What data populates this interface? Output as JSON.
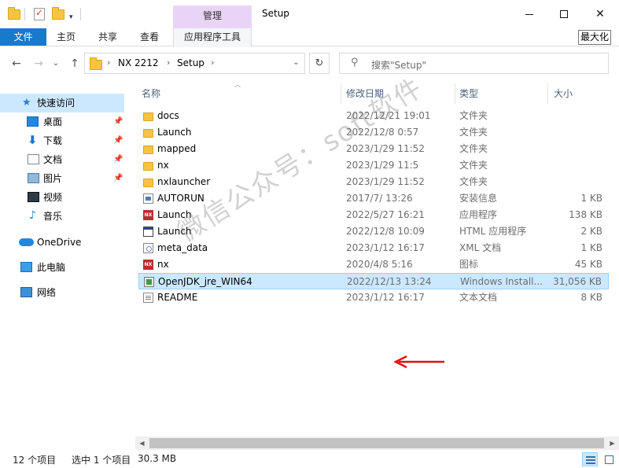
{
  "window": {
    "title": "Setup",
    "context_tab": "管理",
    "tooltip": "最大化"
  },
  "ribbon": {
    "tabs": [
      "文件",
      "主页",
      "共享",
      "查看",
      "应用程序工具"
    ]
  },
  "address": {
    "crumbs": [
      "NX 2212",
      "Setup"
    ],
    "search_placeholder": "搜索\"Setup\""
  },
  "nav": {
    "items": [
      {
        "label": "快速访问",
        "icon": "star-icon"
      },
      {
        "label": "桌面",
        "icon": "desktop-icon",
        "pinned": true
      },
      {
        "label": "下载",
        "icon": "download-icon",
        "pinned": true
      },
      {
        "label": "文档",
        "icon": "documents-icon",
        "pinned": true
      },
      {
        "label": "图片",
        "icon": "pictures-icon",
        "pinned": true
      },
      {
        "label": "视频",
        "icon": "videos-icon"
      },
      {
        "label": "音乐",
        "icon": "music-icon"
      },
      {
        "label": "OneDrive",
        "icon": "cloud-icon"
      },
      {
        "label": "此电脑",
        "icon": "computer-icon"
      },
      {
        "label": "网络",
        "icon": "network-icon"
      }
    ]
  },
  "columns": {
    "name": "名称",
    "date": "修改日期",
    "type": "类型",
    "size": "大小"
  },
  "files": [
    {
      "name": "docs",
      "date": "2022/12/21 19:01",
      "type": "文件夹",
      "size": "",
      "icon": "folder"
    },
    {
      "name": "Launch",
      "date": "2022/12/8 0:57",
      "type": "文件夹",
      "size": "",
      "icon": "folder"
    },
    {
      "name": "mapped",
      "date": "2023/1/29 11:52",
      "type": "文件夹",
      "size": "",
      "icon": "folder"
    },
    {
      "name": "nx",
      "date": "2023/1/29 11:5",
      "type": "文件夹",
      "size": "",
      "icon": "folder"
    },
    {
      "name": "nxlauncher",
      "date": "2023/1/29 11:52",
      "type": "文件夹",
      "size": "",
      "icon": "folder"
    },
    {
      "name": "AUTORUN",
      "date": "2017/7/ 13:26",
      "type": "安装信息",
      "size": "1 KB",
      "icon": "inf"
    },
    {
      "name": "Launch",
      "date": "2022/5/27 16:21",
      "type": "应用程序",
      "size": "138 KB",
      "icon": "nx"
    },
    {
      "name": "Launch",
      "date": "2022/12/8 10:09",
      "type": "HTML 应用程序",
      "size": "2 KB",
      "icon": "html"
    },
    {
      "name": "meta_data",
      "date": "2023/1/12 16:17",
      "type": "XML 文档",
      "size": "1 KB",
      "icon": "xml"
    },
    {
      "name": "nx",
      "date": "2020/4/8 5:16",
      "type": "图标",
      "size": "45 KB",
      "icon": "nx"
    },
    {
      "name": "OpenJDK_jre_WIN64",
      "date": "2022/12/13 13:24",
      "type": "Windows Install...",
      "size": "31,056 KB",
      "icon": "msi",
      "selected": true
    },
    {
      "name": "README",
      "date": "2023/1/12 16:17",
      "type": "文本文档",
      "size": "8 KB",
      "icon": "txt"
    }
  ],
  "status": {
    "count": "12 个项目",
    "selection": "选中 1 个项目",
    "selection_size": "30.3 MB"
  },
  "watermark": "微信公众号：soft软件",
  "colors": {
    "file_tab": "#1979ca",
    "context_tab": "#e9d4f6",
    "selection": "#cce8ff",
    "arrow": "#e01010"
  }
}
